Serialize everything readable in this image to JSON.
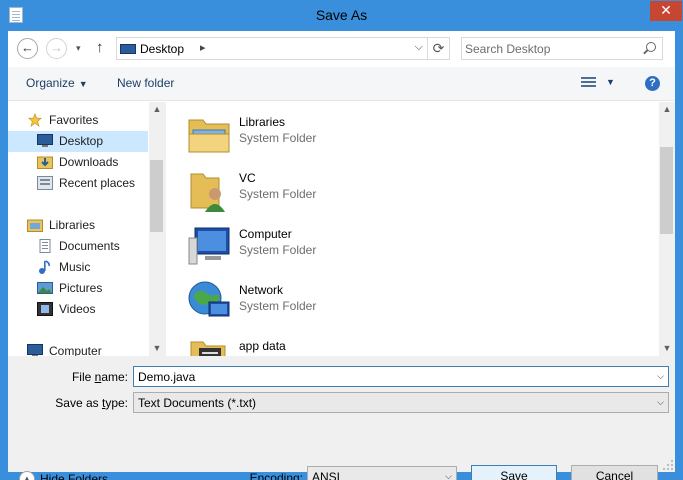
{
  "window": {
    "title": "Save As",
    "close_glyph": "✕"
  },
  "nav": {
    "back_glyph": "←",
    "forward_glyph": "→",
    "history_glyph": "▾",
    "up_glyph": "↑",
    "address": {
      "crumb": "Desktop",
      "crumb_arrow": "▸",
      "dropdown_glyph": "⌵",
      "refresh_glyph": "⟳"
    },
    "search_placeholder": "Search Desktop"
  },
  "toolbar": {
    "organize": "Organize",
    "organize_caret": "▼",
    "new_folder": "New folder",
    "view_caret": "▼",
    "help": "?"
  },
  "sidebar": {
    "items": [
      {
        "label": "Favorites",
        "icon": "star-icon"
      },
      {
        "label": "Desktop",
        "icon": "desktop-icon",
        "selected": true
      },
      {
        "label": "Downloads",
        "icon": "downloads-icon"
      },
      {
        "label": "Recent places",
        "icon": "recent-places-icon"
      },
      {
        "label": "Libraries",
        "icon": "libraries-icon"
      },
      {
        "label": "Documents",
        "icon": "documents-icon"
      },
      {
        "label": "Music",
        "icon": "music-icon"
      },
      {
        "label": "Pictures",
        "icon": "pictures-icon"
      },
      {
        "label": "Videos",
        "icon": "videos-icon"
      },
      {
        "label": "Computer",
        "icon": "computer-icon"
      }
    ],
    "scroll_up": "▲",
    "scroll_down": "▼"
  },
  "content": {
    "items": [
      {
        "name": "Libraries",
        "type": "System Folder",
        "icon": "libraries-folder-icon"
      },
      {
        "name": "VC",
        "type": "System Folder",
        "icon": "user-folder-icon"
      },
      {
        "name": "Computer",
        "type": "System Folder",
        "icon": "computer-icon"
      },
      {
        "name": "Network",
        "type": "System Folder",
        "icon": "network-icon"
      },
      {
        "name": "app data",
        "type": "",
        "icon": "folder-icon"
      }
    ],
    "scroll_up": "▲",
    "scroll_down": "▼"
  },
  "form": {
    "file_name_label_pre": "File ",
    "file_name_label_key": "n",
    "file_name_label_post": "ame:",
    "file_name_value": "Demo.java",
    "save_type_label_pre": "Save as ",
    "save_type_label_key": "t",
    "save_type_label_post": "ype:",
    "save_type_value": "Text Documents (*.txt)",
    "encoding_label_pre": "",
    "encoding_label_key": "E",
    "encoding_label_post": "ncoding:",
    "encoding_value": "ANSI",
    "dropdown_glyph": "⌵"
  },
  "footer": {
    "hide_folders": "Hide Folders",
    "hide_folders_glyph": "▲",
    "save_key": "S",
    "save_rest": "ave",
    "cancel": "Cancel"
  },
  "colors": {
    "titlebar": "#3a8fdc",
    "close": "#c74632",
    "selection": "#cce8ff",
    "link_text": "#1e3f66"
  }
}
